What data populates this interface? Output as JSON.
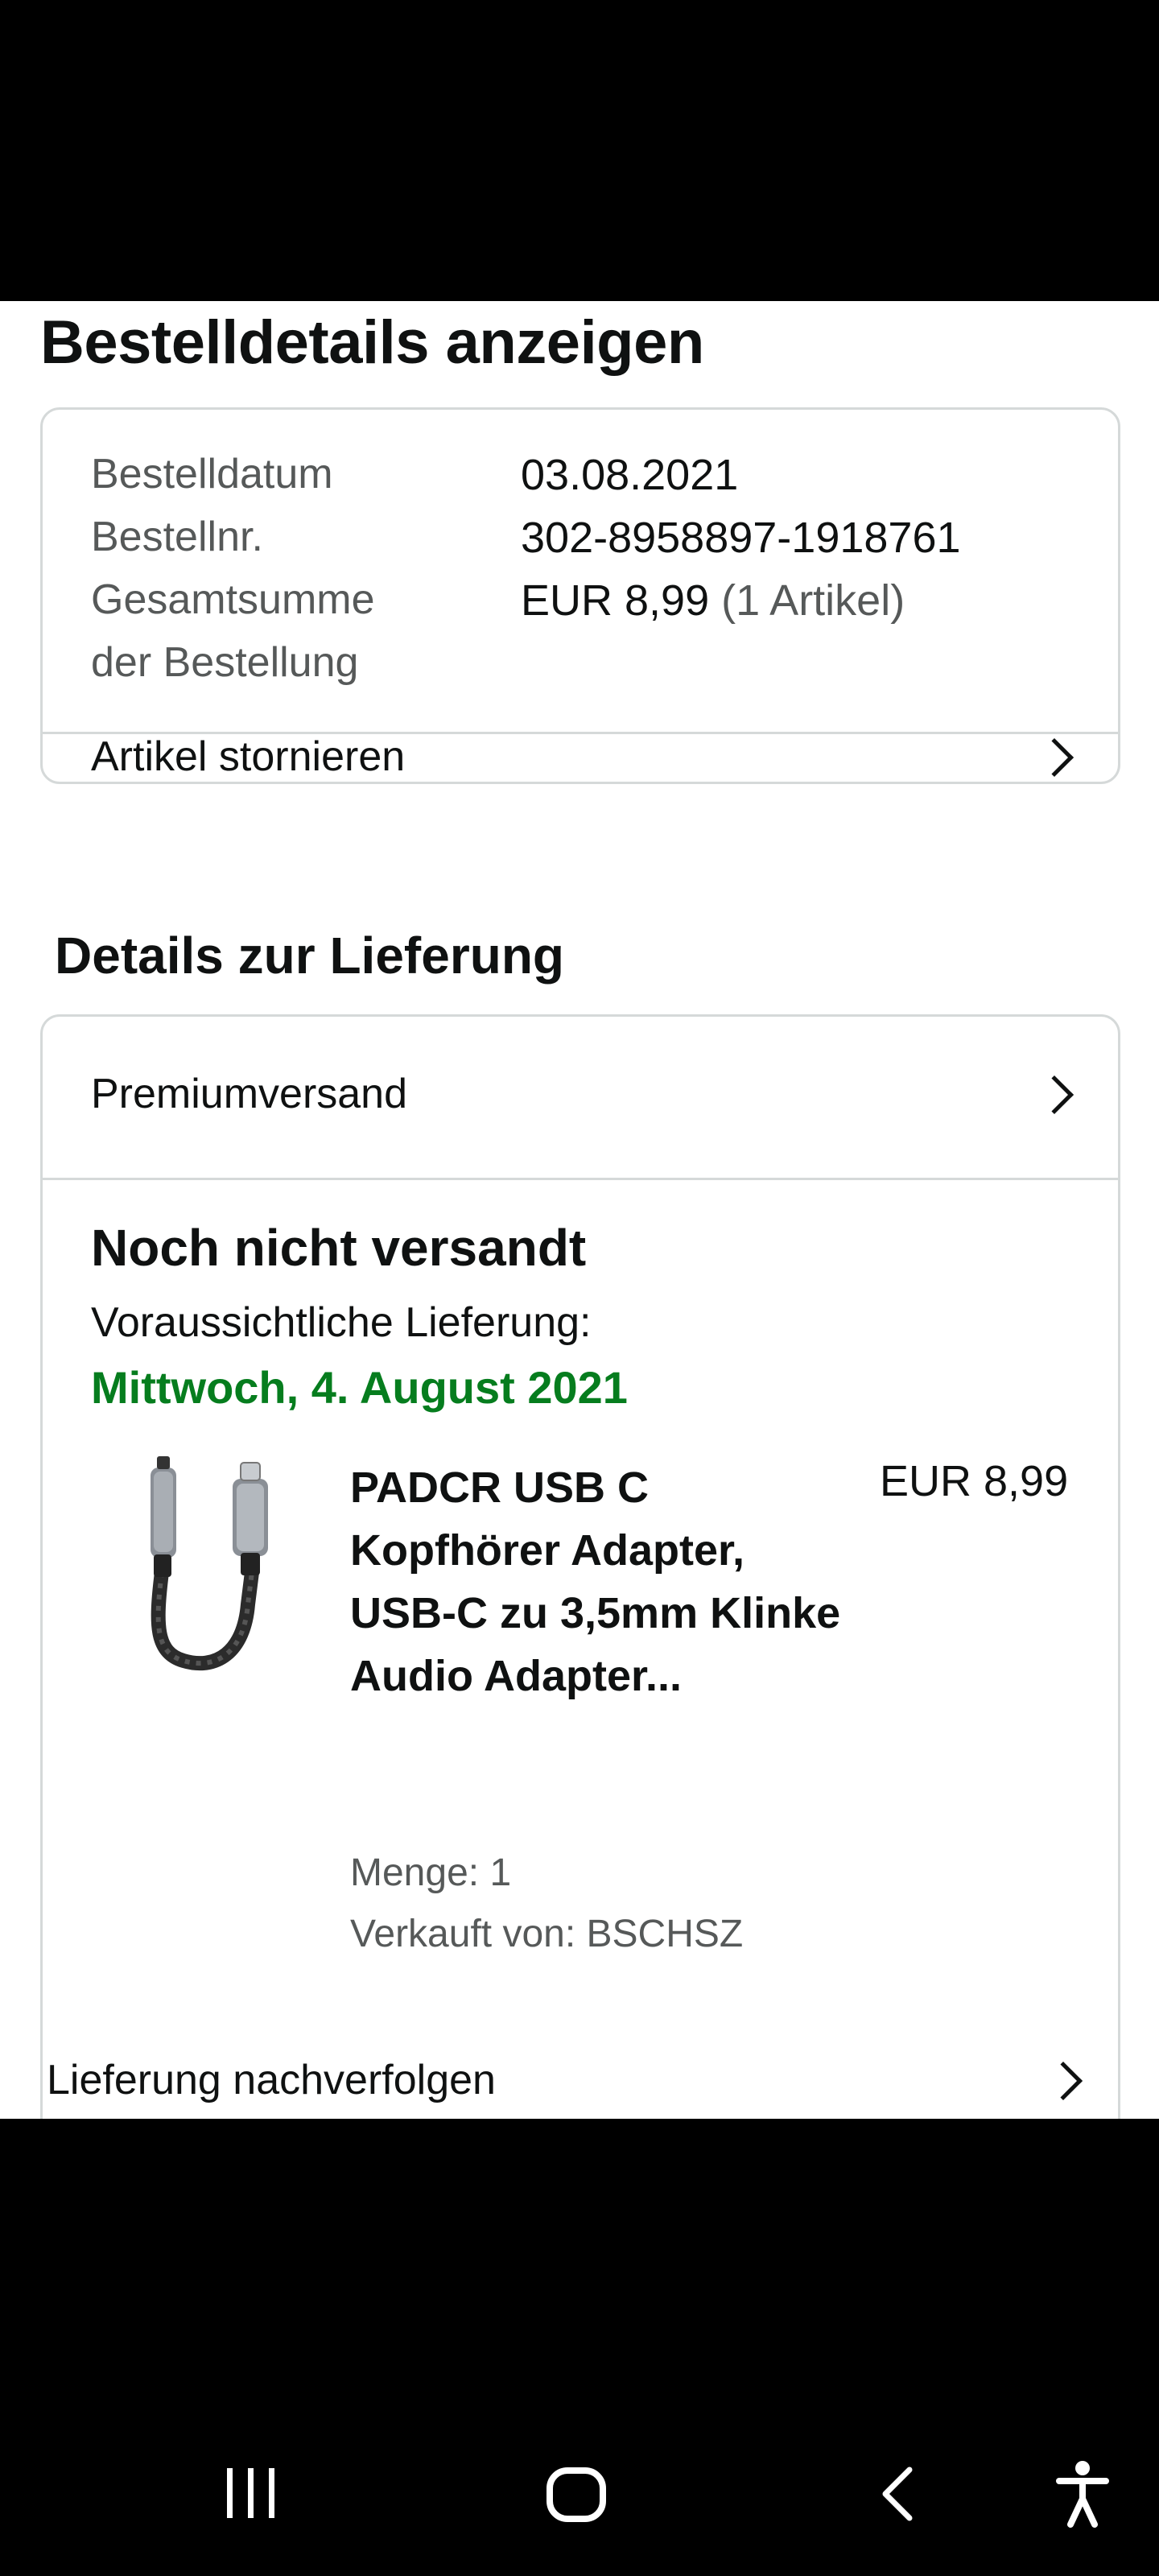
{
  "page_title": "Bestelldetails anzeigen",
  "order": {
    "date_label": "Bestelldatum",
    "date_value": "03.08.2021",
    "number_label": "Bestellnr.",
    "number_value": "302-8958897-1918761",
    "total_label_line1": "Gesamtsumme",
    "total_label_line2": "der Bestellung",
    "total_value": "EUR 8,99",
    "total_items": "(1 Artikel)",
    "cancel_label": "Artikel stornieren"
  },
  "delivery": {
    "section_title": "Details zur Lieferung",
    "shipping_method": "Premiumversand",
    "status": "Noch nicht versandt",
    "estimate_label": "Voraussichtliche Lieferung:",
    "estimate_date": "Mittwoch, 4. August 2021",
    "product": {
      "title": "PADCR USB C Kopfhörer Adapter, USB-C zu 3,5mm Klinke Audio Adapter...",
      "price": "EUR 8,99",
      "quantity": "Menge: 1",
      "seller": "Verkauft von: BSCHSZ",
      "image_icon": "usb-c-audio-adapter-image"
    },
    "track_label": "Lieferung nachverfolgen"
  },
  "colors": {
    "green_date": "#067d1e",
    "border": "#d5d9d9",
    "muted_text": "#565959"
  },
  "navbar_icons": [
    "recent-apps-icon",
    "home-icon",
    "back-icon",
    "accessibility-icon"
  ]
}
